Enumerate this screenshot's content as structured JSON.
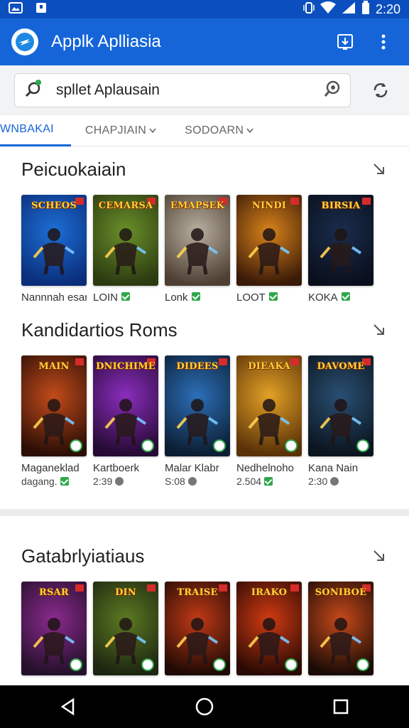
{
  "status_bar": {
    "time": "2:20",
    "left_icons": [
      "image-icon",
      "notification-icon"
    ],
    "right_icons": [
      "vibrate-icon",
      "wifi-icon",
      "signal-icon",
      "battery-icon"
    ]
  },
  "app_bar": {
    "title": "Applk Aplliasia",
    "accent": "#1565d8"
  },
  "search": {
    "value": "spllet Aplausain"
  },
  "tabs": [
    {
      "label": "WNBAKAI",
      "active": true
    },
    {
      "label": "CHAPJIAIN",
      "active": false
    },
    {
      "label": "SODOARN",
      "active": false
    }
  ],
  "sections": [
    {
      "title": "Peicuokaiain",
      "items": [
        {
          "art": "SCHEOS",
          "name": "Nannnah esano",
          "sub": ""
        },
        {
          "art": "CEMARSA",
          "name": "LOIN",
          "sub": ""
        },
        {
          "art": "EMAPSEK",
          "name": "Lonk",
          "sub": ""
        },
        {
          "art": "NINDI",
          "name": "LOOT",
          "sub": ""
        },
        {
          "art": "BIRSIA",
          "name": "KOKA",
          "sub": ""
        }
      ]
    },
    {
      "title": "Kandidartios Roms",
      "items": [
        {
          "art": "MAIN",
          "name": "Maganeklad",
          "sub": "dagang."
        },
        {
          "art": "DNICHIME",
          "name": "Kartboerk",
          "sub": "2:39"
        },
        {
          "art": "DIDEES",
          "name": "Malar Klabr",
          "sub": "S:08"
        },
        {
          "art": "DIEAKA",
          "name": "Nedhelnoho",
          "sub": "2.504"
        },
        {
          "art": "DAVOME",
          "name": "Kana Nain",
          "sub": "2:30"
        }
      ]
    },
    {
      "title": "Gatabrlyiatiaus",
      "items": [
        {
          "art": "RSAR",
          "name": "",
          "sub": ""
        },
        {
          "art": "DIN",
          "name": "",
          "sub": ""
        },
        {
          "art": "TRAISE",
          "name": "",
          "sub": ""
        },
        {
          "art": "IRAKO",
          "name": "",
          "sub": ""
        },
        {
          "art": "SONIBOE",
          "name": "",
          "sub": ""
        }
      ]
    }
  ],
  "nav": [
    "back-icon",
    "home-icon",
    "recents-icon"
  ]
}
